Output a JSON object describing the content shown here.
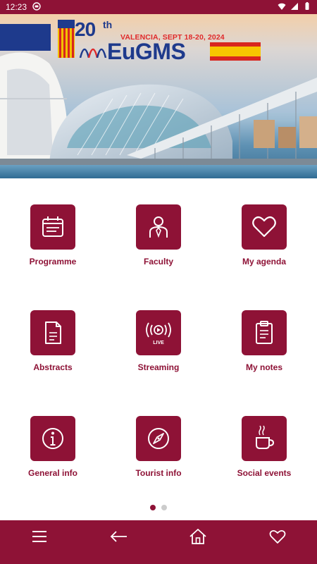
{
  "status_bar": {
    "time": "12:23",
    "icons": [
      "notification-icon",
      "wifi-icon",
      "signal-icon",
      "battery-icon"
    ]
  },
  "banner": {
    "edition": "20",
    "edition_suffix": "th",
    "subtitle": "VALENCIA, SEPT 18-20, 2024",
    "brand": "EuGMS",
    "flag": "spain-flag"
  },
  "menu": {
    "items": [
      {
        "label": "Programme",
        "icon": "calendar-icon"
      },
      {
        "label": "Faculty",
        "icon": "speaker-icon"
      },
      {
        "label": "My agenda",
        "icon": "heart-icon"
      },
      {
        "label": "Abstracts",
        "icon": "document-icon"
      },
      {
        "label": "Streaming",
        "icon": "live-stream-icon"
      },
      {
        "label": "My notes",
        "icon": "clipboard-icon"
      },
      {
        "label": "General info",
        "icon": "info-icon"
      },
      {
        "label": "Tourist info",
        "icon": "compass-icon"
      },
      {
        "label": "Social events",
        "icon": "coffee-icon"
      }
    ]
  },
  "pagination": {
    "current": 1,
    "total": 2
  },
  "bottom_nav": {
    "items": [
      "menu-icon",
      "back-arrow-icon",
      "home-icon",
      "favorites-icon"
    ]
  },
  "colors": {
    "accent": "#8e1236",
    "brand_blue": "#1e3a8c",
    "brand_red": "#e02a2a"
  }
}
